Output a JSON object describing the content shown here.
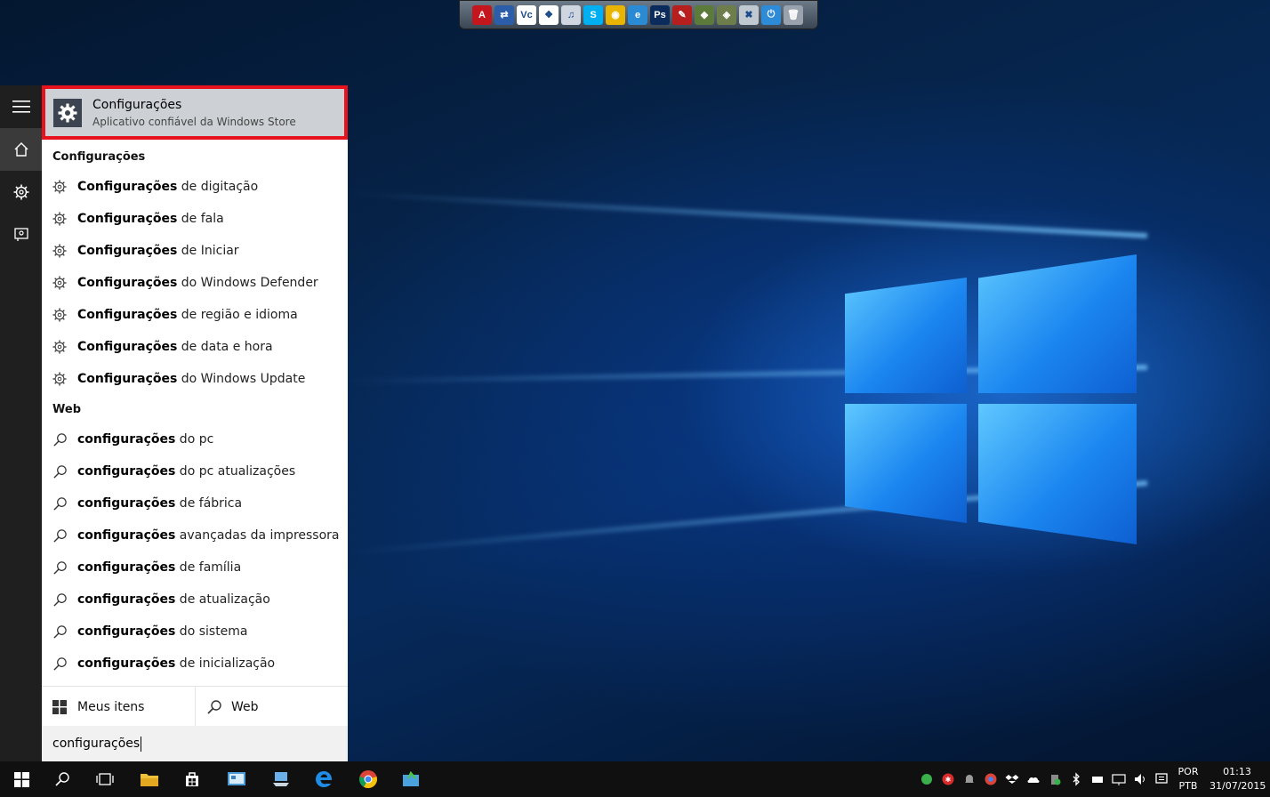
{
  "dock": {
    "icons": [
      {
        "name": "acrobat-icon",
        "glyph": "A",
        "color": "#c4161c"
      },
      {
        "name": "network-icon",
        "glyph": "⇄",
        "color": "#2c5da8"
      },
      {
        "name": "vc-icon",
        "glyph": "Vc",
        "color": "#ffffff"
      },
      {
        "name": "dropbox-icon",
        "glyph": "❖",
        "color": "#ffffff"
      },
      {
        "name": "itunes-icon",
        "glyph": "♫",
        "color": "#d0d6e0"
      },
      {
        "name": "skype-icon",
        "glyph": "S",
        "color": "#00aff0"
      },
      {
        "name": "chrome-icon",
        "glyph": "◉",
        "color": "#e8b400"
      },
      {
        "name": "ie-icon",
        "glyph": "e",
        "color": "#2a8ad4"
      },
      {
        "name": "photoshop-icon",
        "glyph": "Ps",
        "color": "#0b2b5c"
      },
      {
        "name": "tool-red-icon",
        "glyph": "✎",
        "color": "#b71e1e"
      },
      {
        "name": "tool-green-icon",
        "glyph": "◆",
        "color": "#5c7a3a"
      },
      {
        "name": "tool-map-icon",
        "glyph": "◈",
        "color": "#6d7d4c"
      },
      {
        "name": "tool-x-icon",
        "glyph": "✖",
        "color": "#c0c8d0"
      },
      {
        "name": "power-icon",
        "glyph": "⏻",
        "color": "#2e8bd8"
      },
      {
        "name": "recycle-bin-icon",
        "glyph": "🗑",
        "color": "#9aa3ad"
      }
    ]
  },
  "best_match": {
    "title": "Configurações",
    "subtitle": "Aplicativo confiável da Windows Store"
  },
  "settings_section": {
    "heading": "Configurações",
    "items": [
      {
        "bold": "Configurações",
        "rest": " de digitação"
      },
      {
        "bold": "Configurações",
        "rest": " de fala"
      },
      {
        "bold": "Configurações",
        "rest": " de Iniciar"
      },
      {
        "bold": "Configurações",
        "rest": " do Windows Defender"
      },
      {
        "bold": "Configurações",
        "rest": " de região e idioma"
      },
      {
        "bold": "Configurações",
        "rest": " de data e hora"
      },
      {
        "bold": "Configurações",
        "rest": " do Windows Update"
      }
    ]
  },
  "web_section": {
    "heading": "Web",
    "items": [
      {
        "bold": "configurações",
        "rest": " do pc"
      },
      {
        "bold": "configurações",
        "rest": " do pc atualizações"
      },
      {
        "bold": "configurações",
        "rest": " de fábrica"
      },
      {
        "bold": "configurações",
        "rest": " avançadas da impressora"
      },
      {
        "bold": "configurações",
        "rest": " de família"
      },
      {
        "bold": "configurações",
        "rest": " de atualização"
      },
      {
        "bold": "configurações",
        "rest": " do sistema"
      },
      {
        "bold": "configurações",
        "rest": " de inicialização"
      }
    ]
  },
  "filters": {
    "my_items": "Meus itens",
    "web": "Web"
  },
  "search": {
    "query": "configurações"
  },
  "taskbar": {
    "language_line1": "POR",
    "language_line2": "PTB",
    "time": "01:13",
    "date": "31/07/2015"
  },
  "colors": {
    "accent": "#e8121d",
    "taskbar": "#101010",
    "rail": "#1f1f1f"
  }
}
